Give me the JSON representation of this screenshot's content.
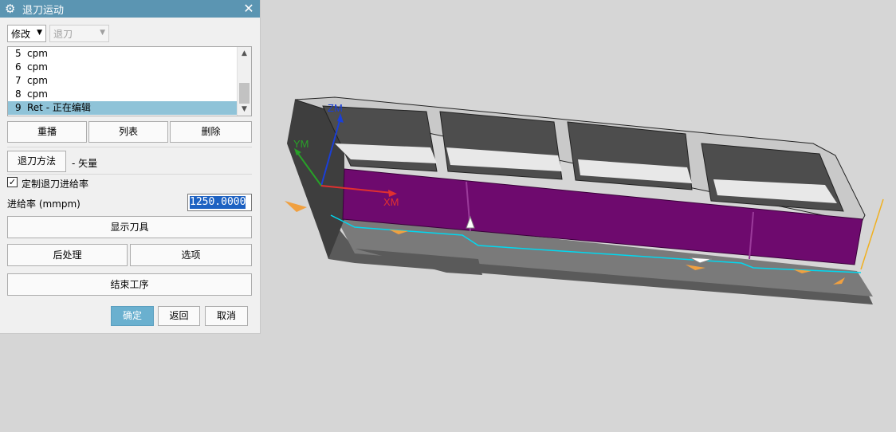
{
  "dialog": {
    "title": "退刀运动",
    "close_symbol": "✕",
    "icon": "gear-icon",
    "mode_select": {
      "value": "修改",
      "arrow": "▼"
    },
    "type_select": {
      "value": "退刀",
      "arrow": "▼"
    },
    "list": {
      "items": [
        {
          "num": "5",
          "text": "cpm"
        },
        {
          "num": "6",
          "text": "cpm"
        },
        {
          "num": "7",
          "text": "cpm"
        },
        {
          "num": "8",
          "text": "cpm"
        },
        {
          "num": "9",
          "text": "Ret  - 正在编辑",
          "selected": true
        }
      ],
      "scroll_up": "▲",
      "scroll_down": "▼"
    },
    "buttons": {
      "replay": "重播",
      "list": "列表",
      "delete": "删除",
      "retract_method": "退刀方法",
      "show_tool": "显示刀具",
      "postprocess": "后处理",
      "options": "选项",
      "finish": "结束工序",
      "ok": "确定",
      "back": "返回",
      "cancel": "取消"
    },
    "retract_method_value": "- 矢量",
    "custom_feed_checkbox": {
      "label": "定制退刀进给率",
      "checked": true,
      "mark": "✓"
    },
    "feed_rate": {
      "label": "进给率 (mmpm)",
      "value": "1250.0000"
    }
  },
  "viewport": {
    "axes": {
      "z": "ZM",
      "y": "YM",
      "x": "XM"
    },
    "colors": {
      "background": "#d6d6d6",
      "part": "#4a4a4a",
      "wall": "#6e0a6e",
      "toolpath": "#00d8f0",
      "x_axis": "#e03030",
      "y_axis": "#28a028",
      "z_axis": "#1a3fd8"
    }
  }
}
